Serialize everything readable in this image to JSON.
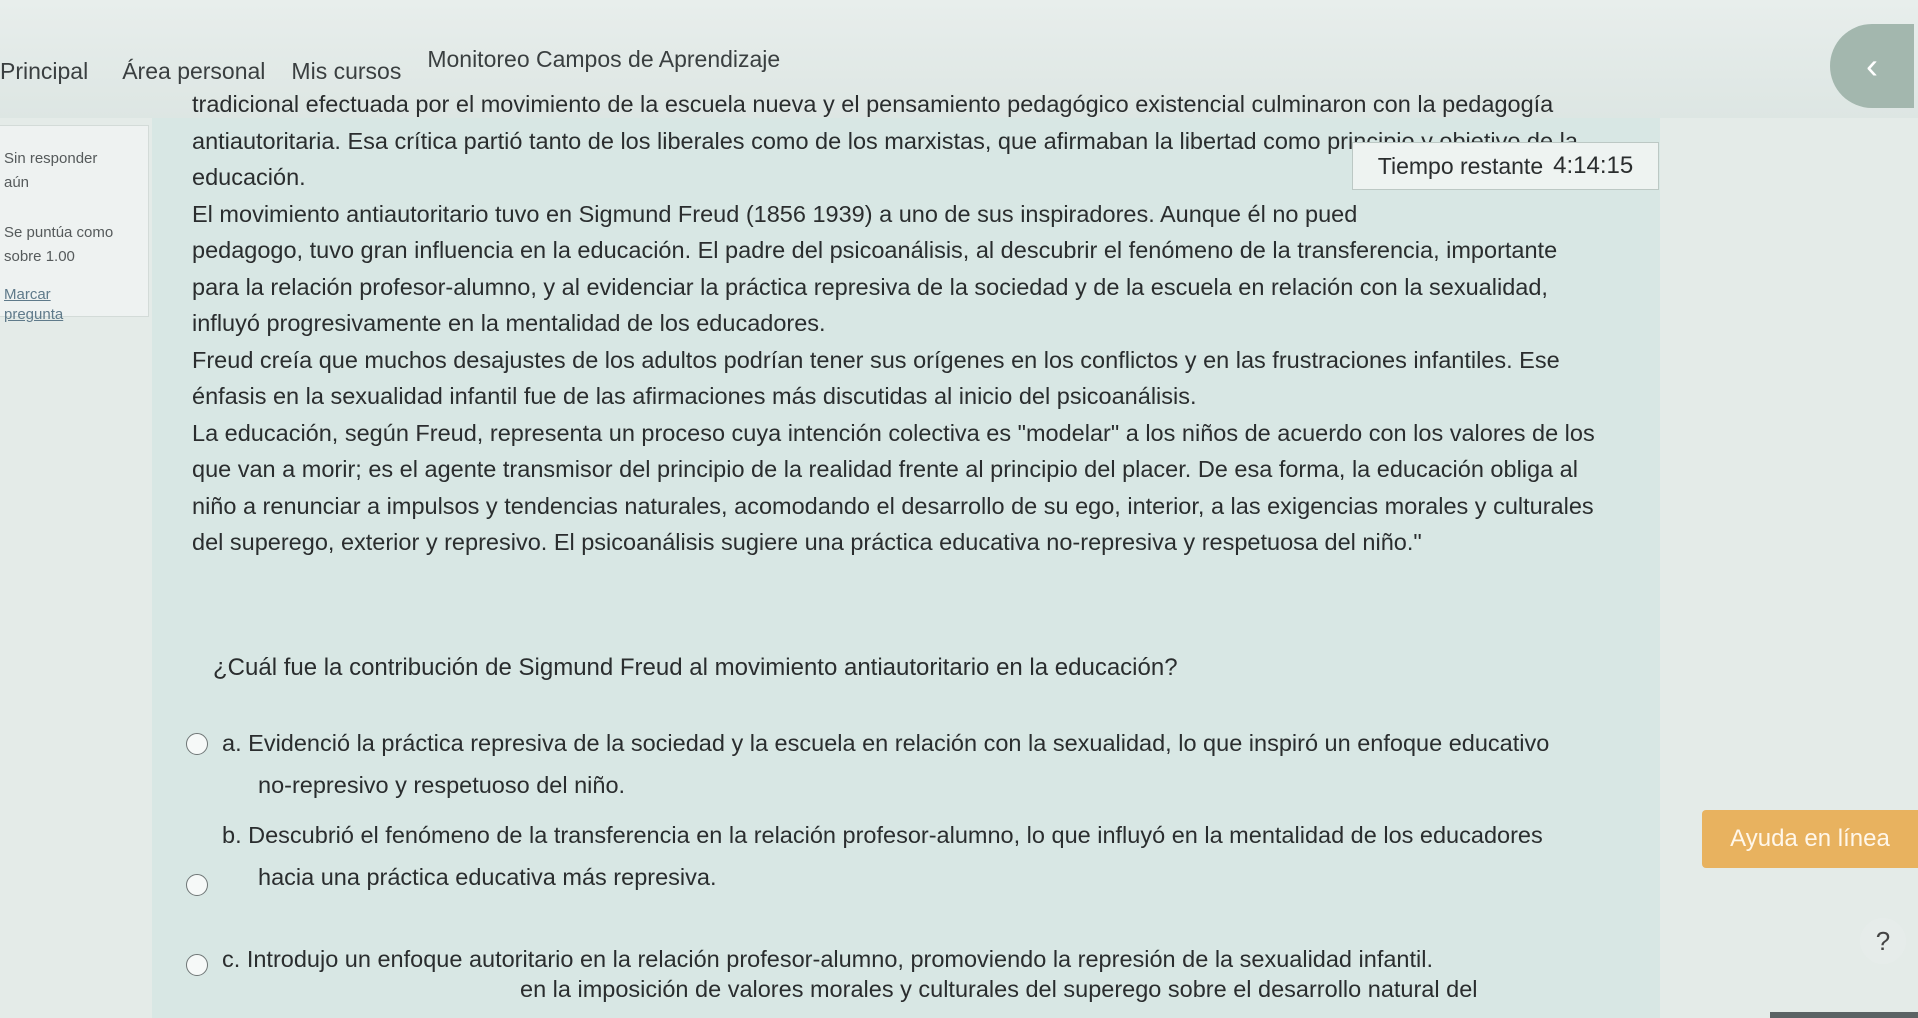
{
  "nav": {
    "items": [
      "Principal",
      "Área personal",
      "Mis cursos"
    ],
    "sub_item": "Monitoreo Campos de Aprendizaje",
    "back_icon": "chevron-left-icon"
  },
  "info": {
    "status": "Sin responder",
    "status2": "aún",
    "score_label": "Se puntúa como",
    "score_value": "sobre 1.00",
    "flag_link": "Marcar",
    "flag_link2": "pregunta"
  },
  "timer": {
    "label": "Tiempo restante",
    "value": "4:14:15"
  },
  "passage": {
    "lines": [
      "tradicional efectuada por el movimiento de la escuela nueva y el pensamiento pedagógico existencial culminaron con la pedagogía",
      "antiautoritaria. Esa crítica partió tanto de los liberales como de los marxistas, que afirmaban la libertad como principio y objetivo de la",
      "educación.",
      "El movimiento antiautoritario tuvo en Sigmund Freud (1856 1939) a uno de sus inspiradores. Aunque él no pued",
      "pedagogo, tuvo gran influencia en la educación. El padre del psicoanálisis, al descubrir el fenómeno de la transferencia, importante",
      "para la relación profesor-alumno, y al evidenciar la práctica represiva de la sociedad y de la escuela en relación con la sexualidad,",
      "influyó progresivamente en la mentalidad de los educadores.",
      "Freud creía que muchos desajustes de los adultos podrían tener sus orígenes en los conflictos y en las frustraciones infantiles. Ese",
      "énfasis en la sexualidad infantil fue de las afirmaciones más discutidas al inicio del psicoanálisis.",
      "La educación, según Freud, representa un proceso cuya intención colectiva es \"modelar\" a los niños de acuerdo con los valores de los",
      "que van a morir; es el agente transmisor del principio de la realidad frente al principio del placer. De esa forma, la educación obliga al",
      "niño a renunciar a impulsos y tendencias naturales, acomodando el desarrollo de su ego, interior, a las exigencias morales y culturales",
      "del superego, exterior y represivo. El psicoanálisis sugiere una práctica educativa no-represiva y respetuosa del niño.\""
    ]
  },
  "question": "¿Cuál fue la contribución de Sigmund Freud al movimiento antiautoritario en la educación?",
  "options": [
    {
      "letter": "a.",
      "line1": "Evidenció la práctica represiva de la sociedad y la escuela en relación con la sexualidad, lo que inspiró un enfoque educativo",
      "line2": "no-represivo y respetuoso del niño."
    },
    {
      "letter": "b.",
      "line1": "Descubrió el fenómeno de la transferencia en la relación profesor-alumno, lo que influyó en la mentalidad de los educadores",
      "line2": "hacia una práctica educativa más represiva."
    },
    {
      "letter": "c.",
      "line1": "Introdujo un enfoque autoritario en la relación profesor-alumno, promoviendo la represión de la sexualidad infantil.",
      "line2": ""
    }
  ],
  "cut_option": "en la imposición de valores morales y culturales del superego sobre el desarrollo natural del",
  "help_button": "Ayuda en línea",
  "help_icon": "?"
}
